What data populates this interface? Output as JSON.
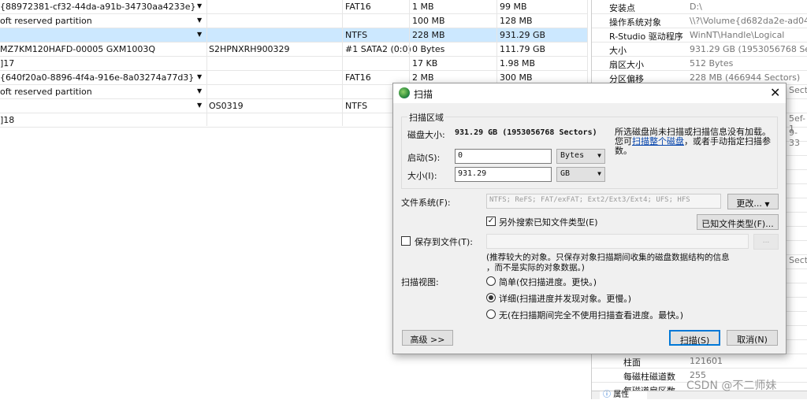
{
  "table": {
    "rows": [
      {
        "name": "{88972381-cf32-44da-a91b-34730aa4233e}",
        "dd": true,
        "col2": "",
        "col3": "FAT16",
        "col4": "1 MB",
        "col5": "99 MB"
      },
      {
        "name": "oft reserved partition",
        "dd": true,
        "col2": "",
        "col3": "",
        "col4": "100 MB",
        "col5": "128 MB"
      },
      {
        "name": "",
        "dd": true,
        "col2": "",
        "col3": "NTFS",
        "col4": "228 MB",
        "col5": "931.29 GB",
        "selected": true
      },
      {
        "name": " MZ7KM120HAFD-00005 GXM1003Q",
        "dd": false,
        "col2": "S2HPNXRH900329",
        "col3": "#1 SATA2 (0:0)",
        "col4": "0 Bytes",
        "col5": "111.79 GB"
      },
      {
        "name": "]17",
        "dd": false,
        "col2": "",
        "col3": "",
        "col4": "17 KB",
        "col5": "1.98 MB"
      },
      {
        "name": "{640f20a0-8896-4f4a-916e-8a03274a77d3}",
        "dd": true,
        "col2": "",
        "col3": "FAT16",
        "col4": "2 MB",
        "col5": "300 MB"
      },
      {
        "name": "oft reserved partition",
        "dd": true,
        "col2": "",
        "col3": "",
        "col4": "",
        "col5": ""
      },
      {
        "name": "",
        "dd": true,
        "col2": "OS0319",
        "col3": "NTFS",
        "col4": "",
        "col5": ""
      },
      {
        "name": "]18",
        "dd": false,
        "col2": "",
        "col3": "",
        "col4": "",
        "col5": ""
      }
    ]
  },
  "properties": {
    "rows": [
      {
        "name": "安装点",
        "value": "D:\\"
      },
      {
        "name": "操作系统对象",
        "value": "\\\\?\\Volume{d682da2e-ad04-"
      },
      {
        "name": "R-Studio 驱动程序",
        "value": "WinNT\\Handle\\Logical"
      },
      {
        "name": "大小",
        "value": "931.29 GB (1953056768 Sect"
      },
      {
        "name": "扇区大小",
        "value": "512 Bytes"
      },
      {
        "name": "分区偏移",
        "value": "228 MB (466944 Sectors)"
      }
    ],
    "partial": [
      "Sect",
      "5ef-1",
      "9-33",
      "Sect"
    ],
    "bottom_rows": [
      {
        "name": "柱面",
        "value": "121601"
      },
      {
        "name": "每磁柱磁道数",
        "value": "255"
      },
      {
        "name": "每磁道扇区数",
        "value": ""
      }
    ],
    "tab_label": "属性"
  },
  "watermark": "CSDN @不二师妹",
  "dialog": {
    "title": "扫描",
    "group_title": "扫描区域",
    "disk_size_label": "磁盘大小:",
    "disk_size_value": "931.29 GB (1953056768 Sectors)",
    "info_text_1": "所选磁盘尚未扫描或扫描信息没有加载。",
    "info_text_2a": "您可",
    "info_link": "扫描整个磁盘",
    "info_text_2b": "，或者手动指定扫描参",
    "info_text_3": "数。",
    "start_label": "启动(S):",
    "start_value": "0",
    "start_unit": "Bytes",
    "size_label": "大小(I):",
    "size_value": "931.29",
    "size_unit": "GB",
    "fs_label": "文件系统(F):",
    "fs_value": "NTFS; ReFS; FAT/exFAT; Ext2/Ext3/Ext4; UFS; HFS",
    "change_button": "更改...",
    "extra_search_label": "另外搜索已知文件类型(E)",
    "extra_search_checked": true,
    "known_types_button": "已知文件类型(F)...",
    "save_label": "保存到文件(T):",
    "save_checked": false,
    "save_value": "",
    "browse_button": "...",
    "save_hint_1": "(推荐较大的对象。只保存对象扫描期间收集的磁盘数据结构的信息",
    "save_hint_2": "，而不是实际的对象数据。)",
    "view_label": "扫描视图:",
    "view_options": [
      "简单(仅扫描进度。更快。)",
      "详细(扫描进度并发现对象。更慢。)",
      "无(在扫描期间完全不使用扫描查看进度。最快。)"
    ],
    "view_selected": 1,
    "advanced_button": "高级 >>",
    "scan_button": "扫描(S)",
    "cancel_button": "取消(N)"
  }
}
